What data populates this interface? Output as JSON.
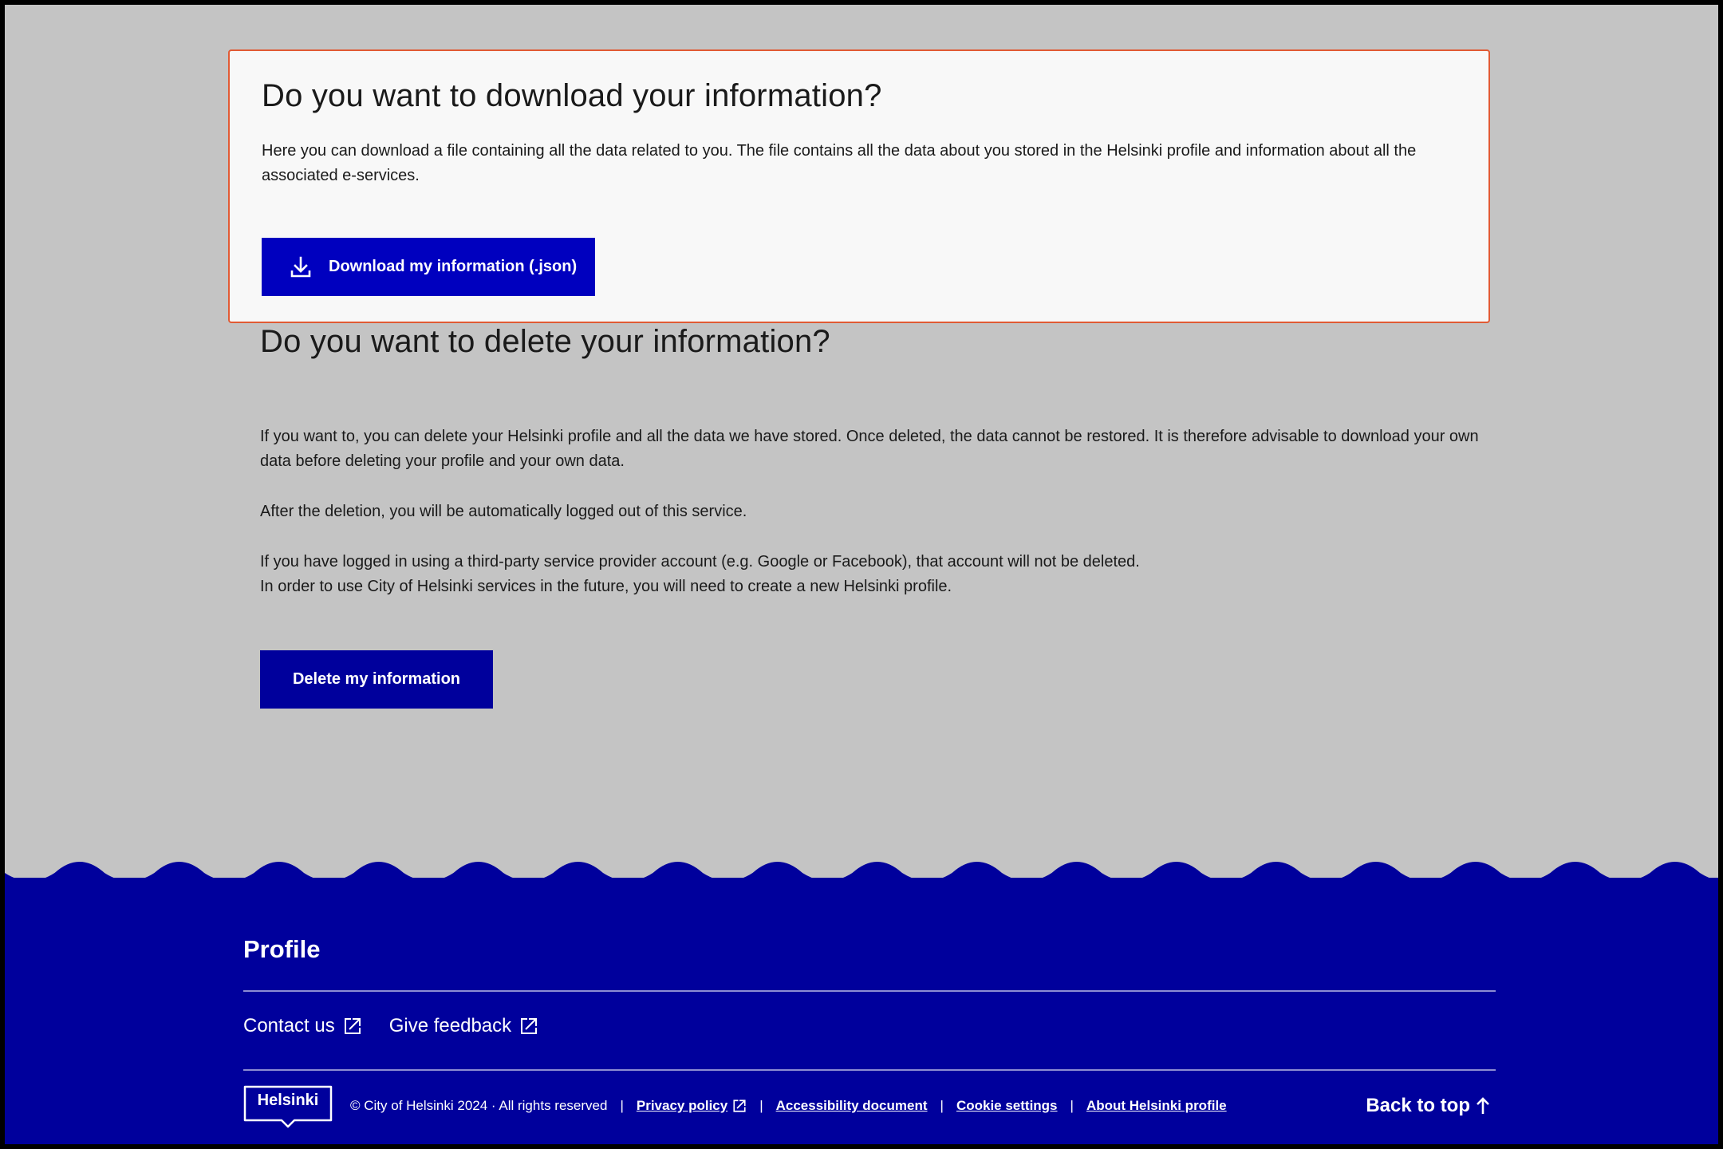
{
  "download": {
    "title": "Do you want to download your information?",
    "description": "Here you can download a file containing all the data related to you. The file contains all the data about you stored in the Helsinki profile and information about all the associated e-services.",
    "button_label": "Download my information (.json)"
  },
  "delete": {
    "title": "Do you want to delete your information?",
    "paragraph1": "If you want to, you can delete your Helsinki profile and all the data we have stored. Once deleted, the data cannot be restored. It is therefore advisable to download your own data before deleting your profile and your own data.",
    "paragraph2": "After the deletion, you will be automatically logged out of this service.",
    "paragraph3_line1": "If you have logged in using a third-party service provider account (e.g. Google or Facebook), that account will not be deleted.",
    "paragraph3_line2": "In order to use City of Helsinki services in the future, you will need to create a new Helsinki profile.",
    "button_label": "Delete my information"
  },
  "footer": {
    "title": "Profile",
    "links": [
      "Contact us",
      "Give feedback"
    ],
    "logo_text": "Helsinki",
    "copyright": "© City of Helsinki 2024 · All rights reserved",
    "legal_links": [
      "Privacy policy",
      "Accessibility document",
      "Cookie settings",
      "About Helsinki profile"
    ],
    "back_to_top": "Back to top"
  },
  "colors": {
    "page_background": "#c4c4c4",
    "card_background": "#f8f8f8",
    "card_border": "#e15a34",
    "primary_button": "#0000bf",
    "footer": "#00009c"
  },
  "icons": [
    "download-icon",
    "external-link-icon",
    "arrow-up-icon",
    "helsinki-logo"
  ]
}
